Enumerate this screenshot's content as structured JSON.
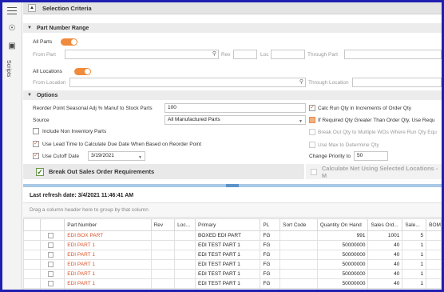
{
  "rail": {
    "vertical_label": "Scripts"
  },
  "criteria": {
    "title": "Selection Criteria",
    "part_range": {
      "title": "Part Number Range",
      "all_parts": "All Parts",
      "from_part": "From Part",
      "rev": "Rev",
      "loc": "Loc",
      "through_part": "Through Part"
    },
    "locations": {
      "all_locations": "All Locations",
      "from_location": "From Location",
      "through_location": "Through Location"
    },
    "options": {
      "title": "Options",
      "reorder_label": "Reorder Point Seasonal Adj % Manuf to Stock Parts",
      "reorder_value": "100",
      "source_label": "Source",
      "source_value": "All Manufactured Parts",
      "include_non_inventory": "Include Non Inventory Parts",
      "use_lead_time": "Use Lead Time to Calculate Due Date When Based on Reorder Point",
      "use_cutoff": "Use Cutoff Date",
      "cutoff_value": "3/19/2021",
      "calc_run_qty": "Calc Run Qty in Increments of Order Qty",
      "if_required": "If Required Qty Greater Than Order Qty, Use Requ",
      "break_out_wos": "Break Out Qty to Multiple WOs Where Run Qty Equ",
      "use_max": "Use Max to Determine Qty",
      "change_priority_label": "Change Priority to",
      "change_priority_value": "50"
    },
    "break_out_sales": "Break Out Sales Order Requirements",
    "calc_net": "Calculate Net Using Selected Locations - M"
  },
  "grid": {
    "refresh": "Last refresh date: 3/4/2021 11:46:41 AM",
    "group_hint": "Drag a column header here to group by that column",
    "columns": [
      "",
      "Part Number",
      "Rev",
      "Loc...",
      "Primary",
      "PL",
      "Sort Code",
      "Quantity On Hand",
      "Sales Ord...",
      "Sale...",
      "BOM"
    ],
    "rows": [
      {
        "part": "EDI BOX PART",
        "primary": "BOXED EDI PART",
        "pl": "FG",
        "qoh": "991",
        "so": "1001",
        "sale": "5"
      },
      {
        "part": "EDI PART 1",
        "primary": "EDI TEST PART 1",
        "pl": "FG",
        "qoh": "50000000",
        "so": "40",
        "sale": "1"
      },
      {
        "part": "EDI PART 1",
        "primary": "EDI TEST PART 1",
        "pl": "FG",
        "qoh": "50000000",
        "so": "40",
        "sale": "1"
      },
      {
        "part": "EDI PART 1",
        "primary": "EDI TEST PART 1",
        "pl": "FG",
        "qoh": "50000000",
        "so": "40",
        "sale": "1"
      },
      {
        "part": "EDI PART 1",
        "primary": "EDI TEST PART 1",
        "pl": "FG",
        "qoh": "50000000",
        "so": "40",
        "sale": "1"
      },
      {
        "part": "EDI PART 1",
        "primary": "EDI TEST PART 1",
        "pl": "FG",
        "qoh": "50000000",
        "so": "40",
        "sale": "1"
      },
      {
        "part": "EDI PART 1",
        "primary": "EDI TEST PART 1",
        "pl": "FG",
        "qoh": "50000000",
        "so": "49",
        "sale": "1"
      }
    ]
  },
  "colors": {
    "accent": "#f08a3c",
    "link": "#d9542b",
    "frame": "#1f1fb0"
  }
}
